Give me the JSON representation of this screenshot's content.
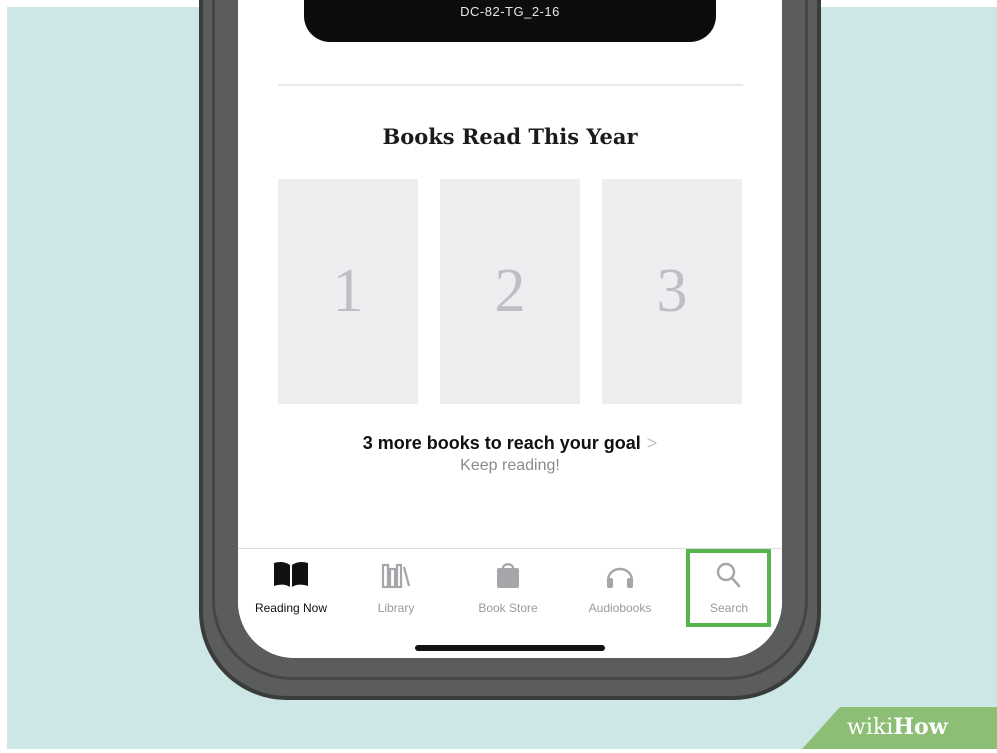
{
  "top_card": {
    "text": "DC-82-TG_2-16"
  },
  "section": {
    "title": "Books Read This Year",
    "slots": [
      "1",
      "2",
      "3"
    ]
  },
  "goal": {
    "bold_count": "3",
    "text": "more books to reach your goal",
    "chevron": ">",
    "subtext": "Keep reading!"
  },
  "tabbar": {
    "tabs": [
      {
        "label": "Reading Now",
        "icon": "book-open-icon",
        "active": true
      },
      {
        "label": "Library",
        "icon": "library-icon",
        "active": false
      },
      {
        "label": "Book Store",
        "icon": "shopping-bag-icon",
        "active": false
      },
      {
        "label": "Audiobooks",
        "icon": "headphones-icon",
        "active": false
      },
      {
        "label": "Search",
        "icon": "search-icon",
        "active": false
      }
    ]
  },
  "watermark": {
    "part1": "wiki",
    "part2": "How"
  },
  "colors": {
    "background": "#cde6e6",
    "highlight": "#55b44c",
    "watermark_green": "#8cbf75"
  }
}
